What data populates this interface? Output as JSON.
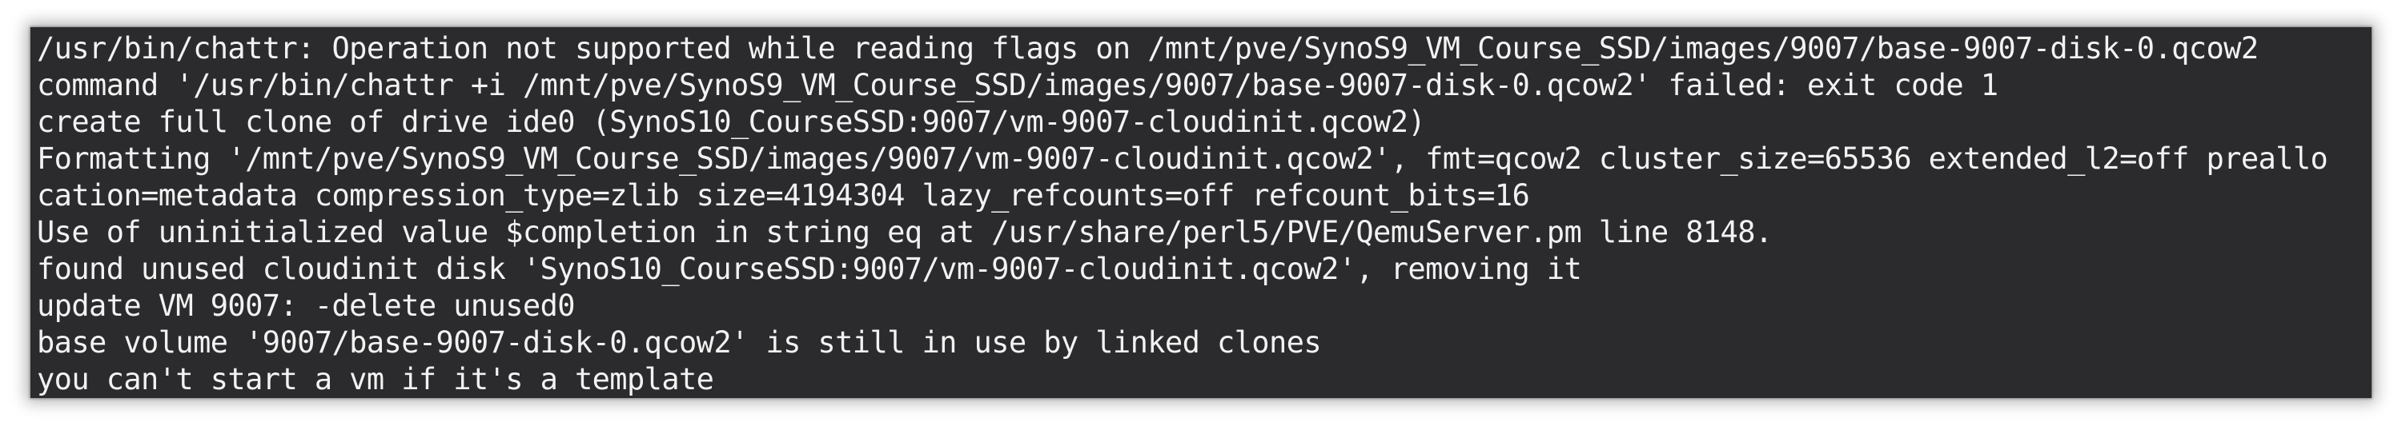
{
  "terminal": {
    "lines": [
      "/usr/bin/chattr: Operation not supported while reading flags on /mnt/pve/SynoS9_VM_Course_SSD/images/9007/base-9007-disk-0.qcow2",
      "command '/usr/bin/chattr +i /mnt/pve/SynoS9_VM_Course_SSD/images/9007/base-9007-disk-0.qcow2' failed: exit code 1",
      "create full clone of drive ide0 (SynoS10_CourseSSD:9007/vm-9007-cloudinit.qcow2)",
      "Formatting '/mnt/pve/SynoS9_VM_Course_SSD/images/9007/vm-9007-cloudinit.qcow2', fmt=qcow2 cluster_size=65536 extended_l2=off preallo",
      "cation=metadata compression_type=zlib size=4194304 lazy_refcounts=off refcount_bits=16",
      "Use of uninitialized value $completion in string eq at /usr/share/perl5/PVE/QemuServer.pm line 8148.",
      "found unused cloudinit disk 'SynoS10_CourseSSD:9007/vm-9007-cloudinit.qcow2', removing it",
      "update VM 9007: -delete unused0",
      "base volume '9007/base-9007-disk-0.qcow2' is still in use by linked clones",
      "you can't start a vm if it's a template"
    ]
  },
  "colors": {
    "background": "#2b2b2e",
    "text": "#f2f2f2"
  }
}
